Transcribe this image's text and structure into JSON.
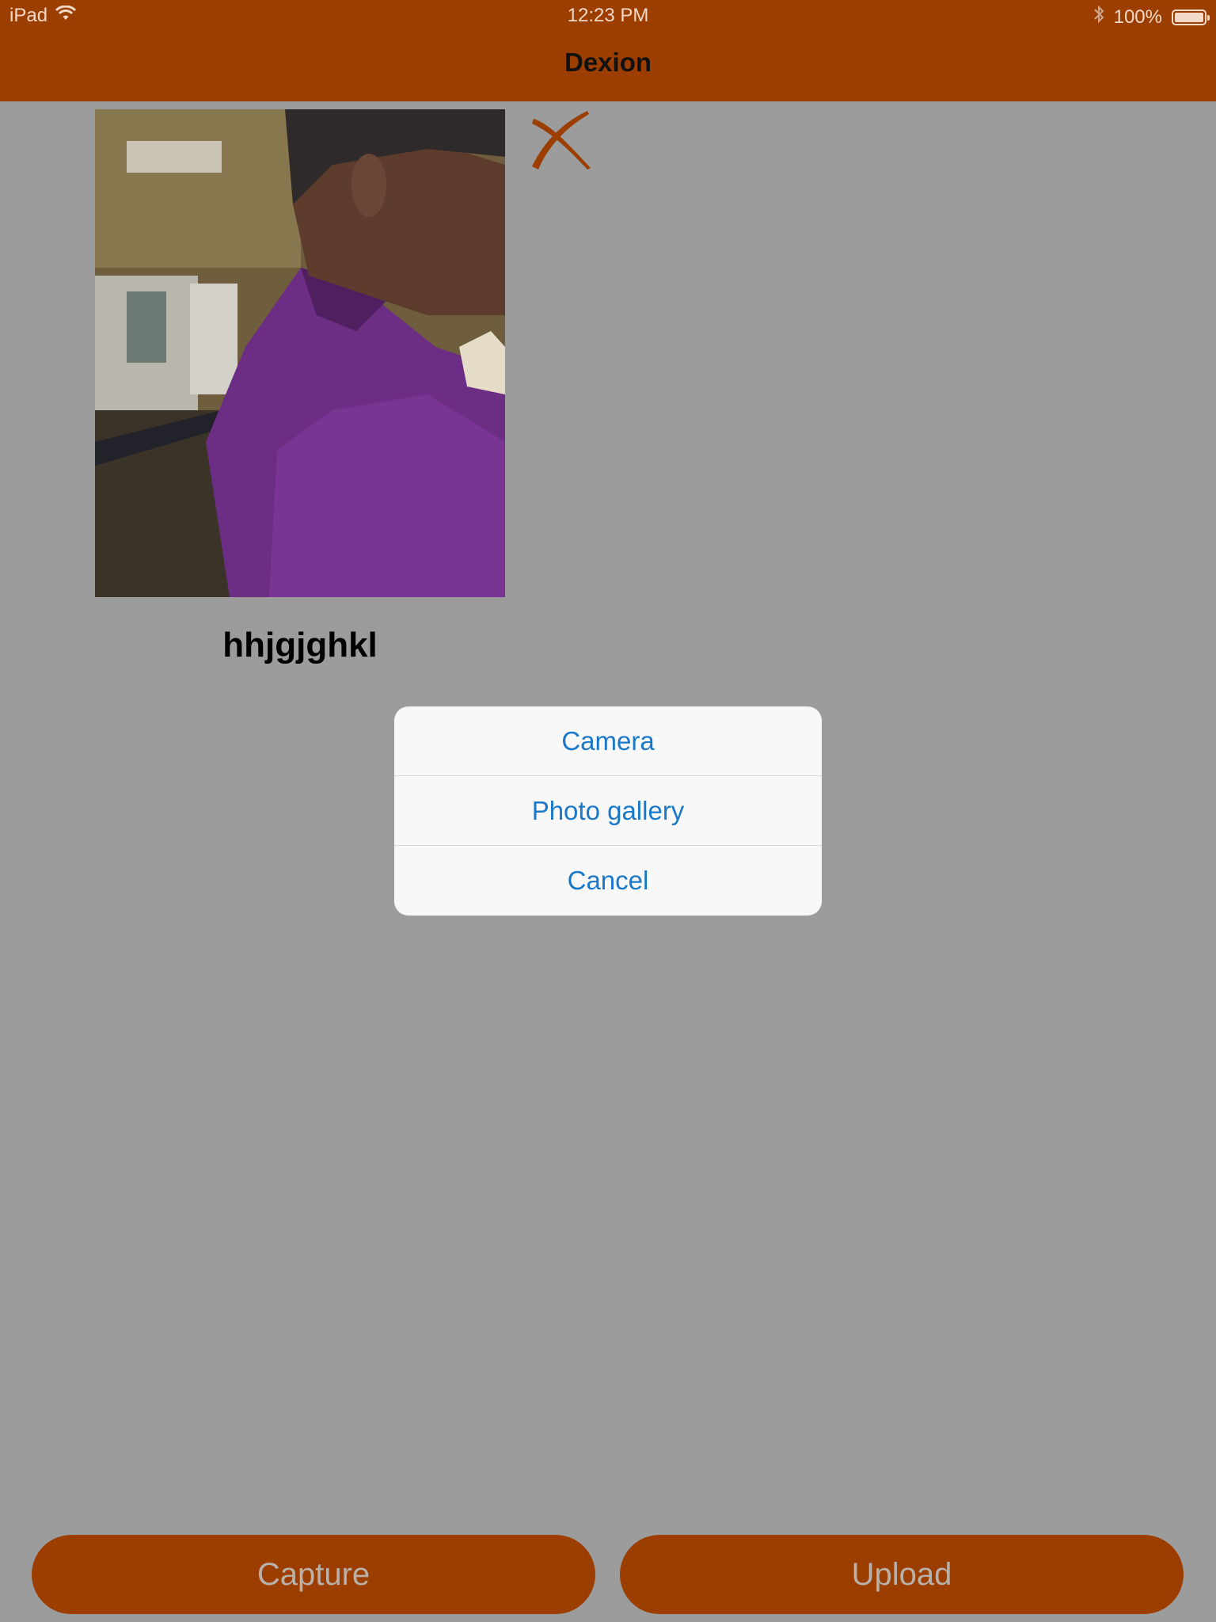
{
  "status_bar": {
    "device": "iPad",
    "time": "12:23 PM",
    "battery_text": "100%"
  },
  "nav": {
    "title": "Dexion"
  },
  "photo": {
    "caption": "hhjgjghkl"
  },
  "action_sheet": {
    "items": [
      "Camera",
      "Photo gallery",
      "Cancel"
    ]
  },
  "buttons": {
    "capture": "Capture",
    "upload": "Upload"
  },
  "colors": {
    "brand": "#9b3e00",
    "overlay_background": "#9c9c9c",
    "action_text": "#1a78c8"
  }
}
